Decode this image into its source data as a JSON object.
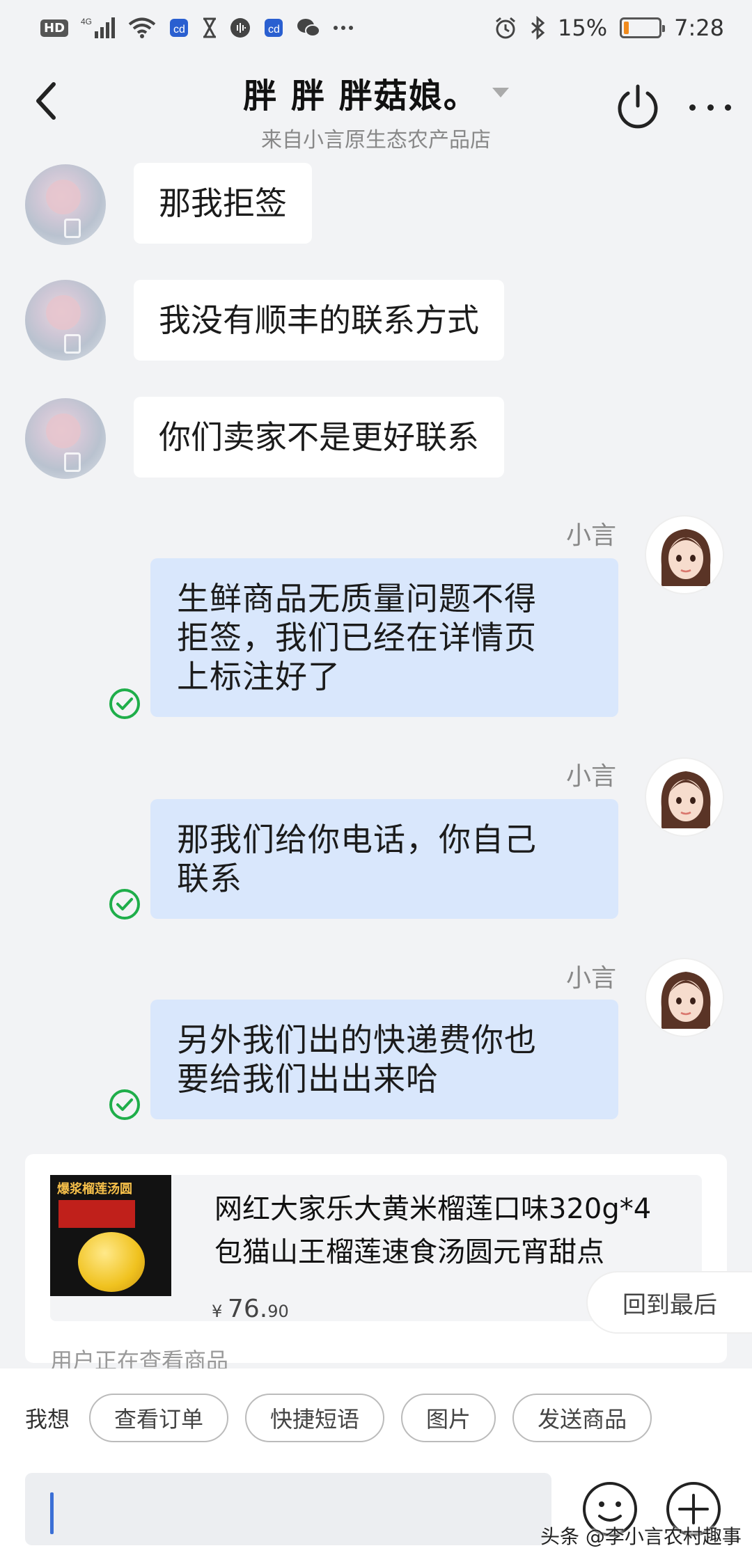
{
  "status_bar": {
    "hd": "HD",
    "network": "4G",
    "battery_percent": "15%",
    "battery_level": 0.15,
    "time": "7:28",
    "battery_color": "#f08a1c"
  },
  "header": {
    "title": "胖 胖 胖菇娘。",
    "subtitle": "来自小言原生态农产品店",
    "back_icon": "chevron-left-icon",
    "power_icon": "power-icon",
    "more_icon": "more-icon"
  },
  "messages": [
    {
      "side": "left",
      "text": "那我拒签"
    },
    {
      "side": "left",
      "text": "我没有顺丰的联系方式"
    },
    {
      "side": "left",
      "text": "你们卖家不是更好联系"
    },
    {
      "side": "right",
      "sender": "小言",
      "line1": "生鲜商品无质量问题不得",
      "line2": "拒签，我们已经在详情页",
      "line3": "上标注好了"
    },
    {
      "side": "right",
      "sender": "小言",
      "line1": "那我们给你电话，你自己",
      "line2": "联系"
    },
    {
      "side": "right",
      "sender": "小言",
      "line1": "另外我们出的快递费你也",
      "line2": "要给我们出出来哈"
    }
  ],
  "product": {
    "thumb_title": "爆浆榴莲汤圆",
    "name_line1": "网红大家乐大黄米榴莲口味320g*4",
    "name_line2": "包猫山王榴莲速食汤圆元宵甜点",
    "price_symbol": "¥",
    "price_int": "76.",
    "price_dec": "90",
    "viewing": "用户正在查看商品"
  },
  "back_to_latest": "回到最后",
  "quick_bar": {
    "label": "我想",
    "chips": [
      "查看订单",
      "快捷短语",
      "图片",
      "发送商品"
    ]
  },
  "input": {
    "emoji_icon": "emoji-icon",
    "plus_icon": "plus-icon"
  },
  "watermark": "头条 @李小言农村趣事",
  "colors": {
    "bg": "#f2f3f5",
    "bubble_left": "#ffffff",
    "bubble_right": "#d9e7fc",
    "check": "#1fae4a",
    "cursor": "#3b6fd6"
  }
}
